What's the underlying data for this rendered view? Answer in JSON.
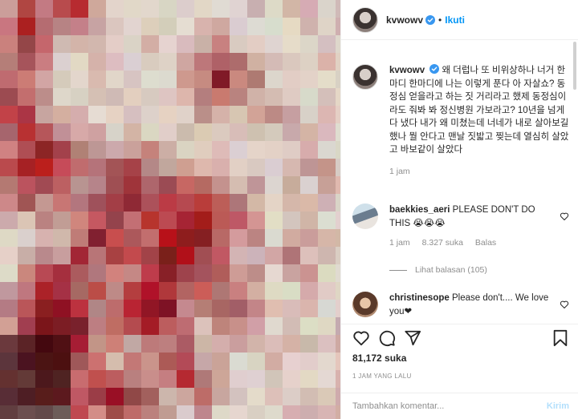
{
  "header": {
    "username": "kvwowv",
    "separator": "•",
    "follow_label": "Ikuti",
    "verified_icon": "verified-badge-icon"
  },
  "caption": {
    "username": "kvwowv",
    "text": "왜 더럽나 또 비위상하나 너거 한마디 한마디에 나는 이렇게 푼다 아 자살쇼? 동정심 얻을라고 하는 짓 거리라고 했제 동정심이라도 줘봐 봐 정신병원 가보라고? 10년을 넘게 다 냈다 내가 왜 미쳤는데 너네가 내로 살아보길 했나 뭘 안다고 맨날 짓밟고 찢는데 열심히 살았고 바보같이 살았다",
    "time": "1 jam"
  },
  "comments": [
    {
      "username": "baekkies_aeri",
      "text": "PLEASE DON'T DO THIS ",
      "emoji": "😭😭😭",
      "time": "1 jam",
      "likes": "8.327 suka",
      "reply_label": "Balas",
      "view_replies": "Lihat balasan (105)"
    },
    {
      "username": "christinesope",
      "text": "Please don't.... We love you",
      "emoji": "❤"
    }
  ],
  "actions": {
    "like_icon": "heart-icon",
    "comment_icon": "comment-icon",
    "share_icon": "share-icon",
    "save_icon": "bookmark-icon"
  },
  "likes_count": "81,172 suka",
  "time_ago": "1 JAM YANG LALU",
  "add_comment": {
    "placeholder": "Tambahkan komentar...",
    "post_label": "Kirim"
  },
  "colors": {
    "accent": "#0095f6",
    "post_disabled": "#b2dffc",
    "blood": "#a01822",
    "muted": "#8e8e8e"
  }
}
